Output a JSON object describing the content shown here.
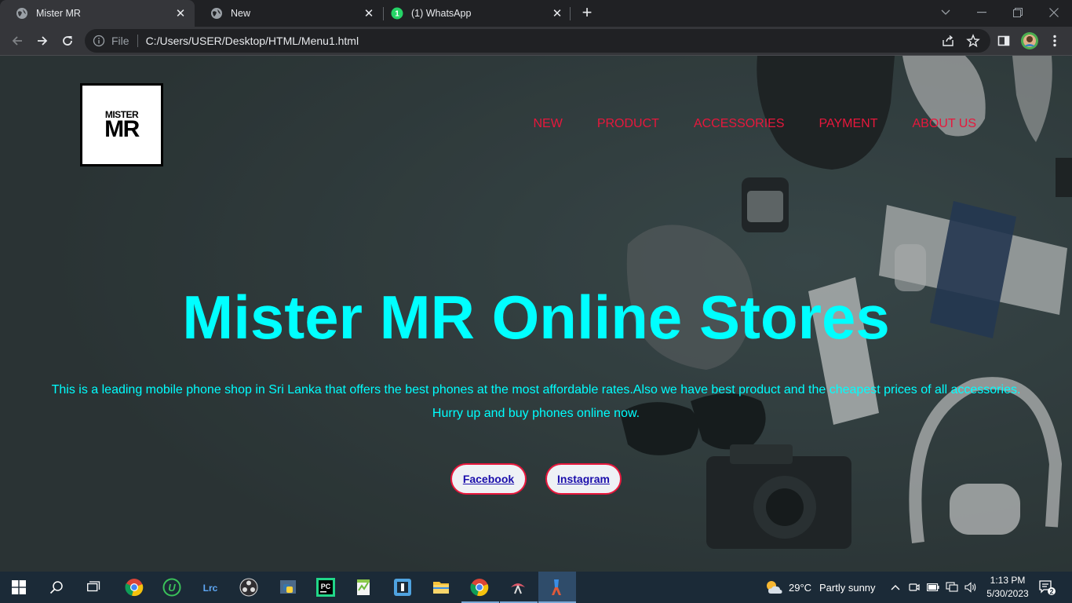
{
  "browser": {
    "tabs": [
      {
        "title": "Mister MR",
        "active": true,
        "icon": "globe-icon"
      },
      {
        "title": "New",
        "active": false,
        "icon": "globe-icon"
      },
      {
        "title": "(1) WhatsApp",
        "active": false,
        "icon": "whatsapp-icon",
        "badge": "1"
      }
    ],
    "address": {
      "scheme_label": "File",
      "url": "C:/Users/USER/Desktop/HTML/Menu1.html"
    }
  },
  "site": {
    "logo": {
      "line1": "MISTER",
      "line2": "MR"
    },
    "nav": [
      "NEW",
      "PRODUCT",
      "ACCESSORIES",
      "PAYMENT",
      "ABOUT US"
    ],
    "hero_title": "Mister MR Online Stores",
    "hero_text_line1": "This is a leading mobile phone shop in Sri Lanka that offers the best phones at the most affordable rates.Also we have best product and the cheapest prices of all accessories.",
    "hero_text_line2": "Hurry up and buy phones online now.",
    "buttons": [
      {
        "label": "Facebook"
      },
      {
        "label": "Instagram"
      }
    ],
    "colors": {
      "accent": "#e8173c",
      "title": "#00ffff",
      "link": "#1a0dab"
    }
  },
  "taskbar": {
    "weather": {
      "temp": "29°C",
      "condition": "Partly sunny"
    },
    "clock": {
      "time": "1:13 PM",
      "date": "5/30/2023"
    },
    "notification_count": "2"
  }
}
